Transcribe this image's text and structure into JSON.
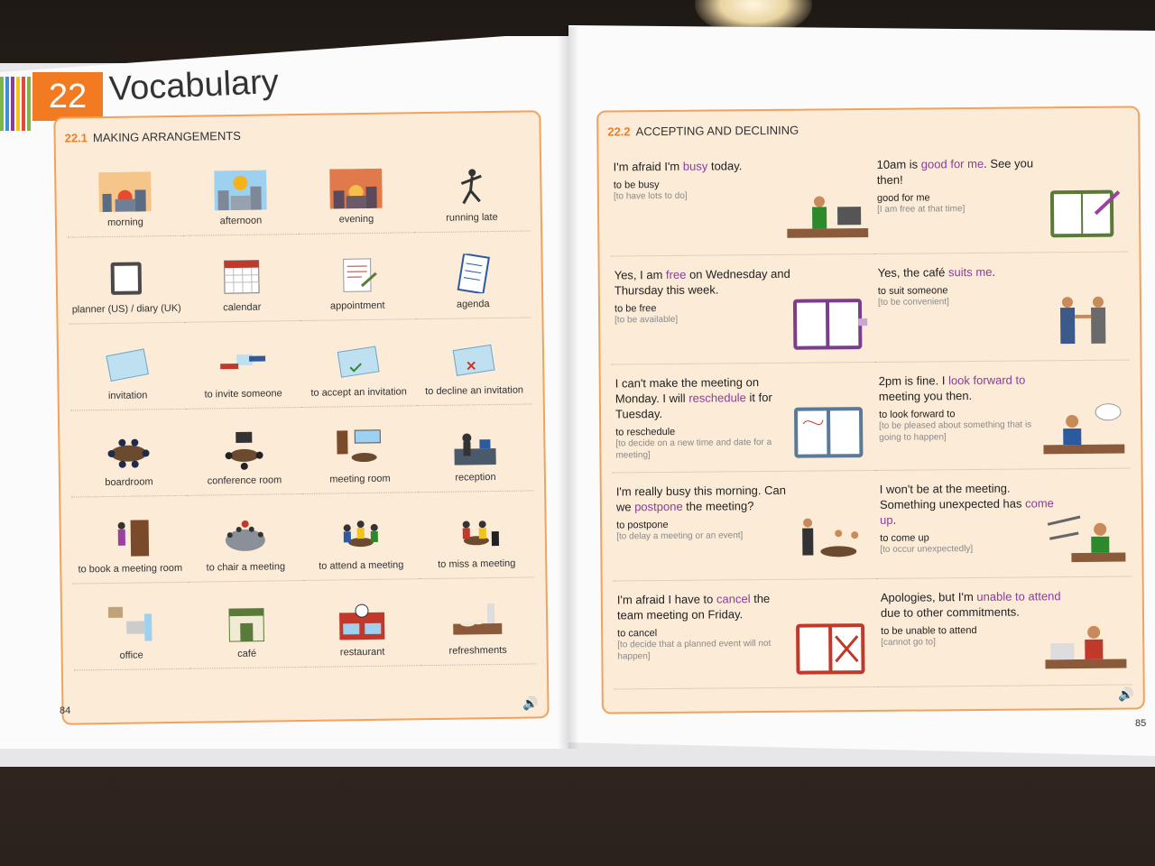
{
  "chapter": {
    "number": "22",
    "title": "Vocabulary"
  },
  "left_section": {
    "number": "22.1",
    "title": "MAKING ARRANGEMENTS",
    "items": [
      {
        "label": "morning",
        "icon": "sunrise-city-icon"
      },
      {
        "label": "afternoon",
        "icon": "sun-city-icon"
      },
      {
        "label": "evening",
        "icon": "sunset-city-icon"
      },
      {
        "label": "running late",
        "icon": "running-man-icon"
      },
      {
        "label": "planner (US) / diary (UK)",
        "icon": "planner-icon"
      },
      {
        "label": "calendar",
        "icon": "calendar-icon"
      },
      {
        "label": "appointment",
        "icon": "appointment-note-icon"
      },
      {
        "label": "agenda",
        "icon": "agenda-icon"
      },
      {
        "label": "invitation",
        "icon": "invitation-card-icon"
      },
      {
        "label": "to invite someone",
        "icon": "handing-card-icon"
      },
      {
        "label": "to accept an invitation",
        "icon": "accept-card-icon"
      },
      {
        "label": "to decline an invitation",
        "icon": "decline-card-icon"
      },
      {
        "label": "boardroom",
        "icon": "boardroom-table-icon"
      },
      {
        "label": "conference room",
        "icon": "conference-room-icon"
      },
      {
        "label": "meeting room",
        "icon": "meeting-room-icon"
      },
      {
        "label": "reception",
        "icon": "reception-desk-icon"
      },
      {
        "label": "to book a meeting room",
        "icon": "booking-door-icon"
      },
      {
        "label": "to chair a meeting",
        "icon": "chair-meeting-icon"
      },
      {
        "label": "to attend a meeting",
        "icon": "attend-meeting-icon"
      },
      {
        "label": "to miss a meeting",
        "icon": "miss-meeting-icon"
      },
      {
        "label": "office",
        "icon": "office-icon"
      },
      {
        "label": "café",
        "icon": "cafe-icon"
      },
      {
        "label": "restaurant",
        "icon": "restaurant-icon"
      },
      {
        "label": "refreshments",
        "icon": "refreshments-icon"
      }
    ]
  },
  "right_section": {
    "number": "22.2",
    "title": "ACCEPTING AND DECLINING",
    "items": [
      {
        "pre": "I'm afraid I'm ",
        "hl": "busy",
        "post": " today.",
        "term": "to be busy",
        "def": "[to have lots to do]",
        "icon": "busy-desk-icon"
      },
      {
        "pre": "10am is ",
        "hl": "good for me",
        "post": ". See you then!",
        "term": "good for me",
        "def": "[I am free at that time]",
        "icon": "writing-planner-icon"
      },
      {
        "pre": "Yes, I am ",
        "hl": "free",
        "post": " on Wednesday and Thursday this week.",
        "term": "to be free",
        "def": "[to be available]",
        "icon": "open-planner-icon"
      },
      {
        "pre": "Yes, the café ",
        "hl": "suits me",
        "post": ".",
        "term": "to suit someone",
        "def": "[to be convenient]",
        "icon": "handshake-icon"
      },
      {
        "pre": "I can't make the meeting on Monday. I will ",
        "hl": "reschedule",
        "post": " it for Tuesday.",
        "term": "to reschedule",
        "def": "[to decide on a new time and date for a meeting]",
        "icon": "reschedule-planner-icon"
      },
      {
        "pre": "2pm is fine. I ",
        "hl": "look forward to",
        "post": " meeting you then.",
        "term": "to look forward to",
        "def": "[to be pleased about something that is going to happen]",
        "icon": "thinking-man-icon"
      },
      {
        "pre": "I'm really busy this morning. Can we ",
        "hl": "postpone",
        "post": " the meeting?",
        "term": "to postpone",
        "def": "[to delay a meeting or an event]",
        "icon": "postpone-meeting-icon"
      },
      {
        "pre": "I won't be at the meeting. Something unexpected has ",
        "hl": "come up",
        "post": ".",
        "term": "to come up",
        "def": "[to occur unexpectedly]",
        "icon": "phone-call-icon"
      },
      {
        "pre": "I'm afraid I have to ",
        "hl": "cancel",
        "post": " the team meeting on Friday.",
        "term": "to cancel",
        "def": "[to decide that a planned event will not happen]",
        "icon": "cancel-planner-icon"
      },
      {
        "pre": "Apologies, but I'm ",
        "hl": "unable to attend",
        "post": " due to other commitments.",
        "term": "to be unable to attend",
        "def": "[cannot go to]",
        "icon": "stressed-desk-icon"
      }
    ]
  },
  "page_numbers": {
    "left": "84",
    "right": "85"
  },
  "colors": {
    "accent": "#f27b21",
    "highlight": "#8a3d9e",
    "panel": "#fbebd7"
  }
}
